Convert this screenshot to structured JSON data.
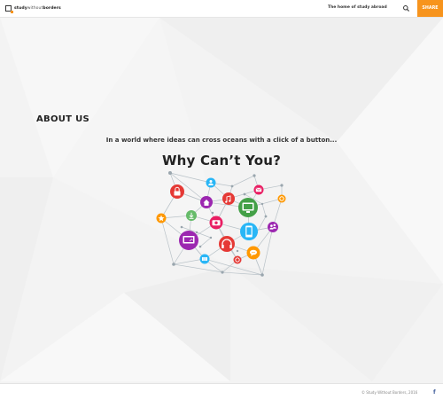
{
  "header": {
    "logo": {
      "bold": "study",
      "thin": "without",
      "bold2": "borders"
    },
    "tagline": "The home of study abroad",
    "share_label": "SHARE"
  },
  "main": {
    "heading": "ABOUT US",
    "subline": "In a world where ideas can cross oceans with a click of a button...",
    "headline": "Why Can’t You?"
  },
  "footer": {
    "copyright": "© Study Without Borders, 2016",
    "facebook_glyph": "f"
  },
  "graphic": {
    "icons": [
      {
        "name": "lock-icon",
        "color": "#e53935"
      },
      {
        "name": "person-icon",
        "color": "#29b6f6"
      },
      {
        "name": "star-icon",
        "color": "#ff9800"
      },
      {
        "name": "home-icon",
        "color": "#9c27b0"
      },
      {
        "name": "music-icon",
        "color": "#e53935"
      },
      {
        "name": "monitor-icon",
        "color": "#43a047"
      },
      {
        "name": "camera-icon",
        "color": "#e91e63"
      },
      {
        "name": "mail-icon",
        "color": "#e91e63"
      },
      {
        "name": "download-icon",
        "color": "#66bb6a"
      },
      {
        "name": "laptop-icon",
        "color": "#9c27b0"
      },
      {
        "name": "headphones-icon",
        "color": "#e53935"
      },
      {
        "name": "phone-icon",
        "color": "#29b6f6"
      },
      {
        "name": "people-icon",
        "color": "#9c27b0"
      },
      {
        "name": "chat-icon",
        "color": "#ff9800"
      },
      {
        "name": "film-icon",
        "color": "#29b6f6"
      },
      {
        "name": "record-icon",
        "color": "#e53935"
      },
      {
        "name": "gear-icon",
        "color": "#ff9800"
      }
    ]
  }
}
